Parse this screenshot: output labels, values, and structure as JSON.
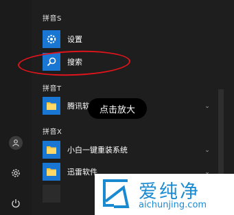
{
  "rail": {
    "user_icon": "user-icon",
    "settings_icon": "gear-icon",
    "power_icon": "power-icon"
  },
  "menu": {
    "sections": [
      {
        "header": "拼音S"
      },
      {
        "header": "拼音T"
      },
      {
        "header": "拼音X"
      }
    ],
    "items": [
      {
        "label": "设置",
        "icon": "gear-icon"
      },
      {
        "label": "搜索",
        "icon": "search-icon"
      },
      {
        "label": "腾讯软",
        "icon": "folder-icon"
      },
      {
        "label": "小白一键重装系统",
        "icon": "folder-icon"
      },
      {
        "label": "迅雷软件",
        "icon": "folder-icon"
      }
    ]
  },
  "tooltip": {
    "text": "点击放大"
  },
  "watermark": {
    "title": "爱纯净",
    "url": "aichunjing.com"
  },
  "colors": {
    "accent": "#1976d2",
    "highlight": "#e0141b",
    "watermark": "#1a8ad0"
  }
}
